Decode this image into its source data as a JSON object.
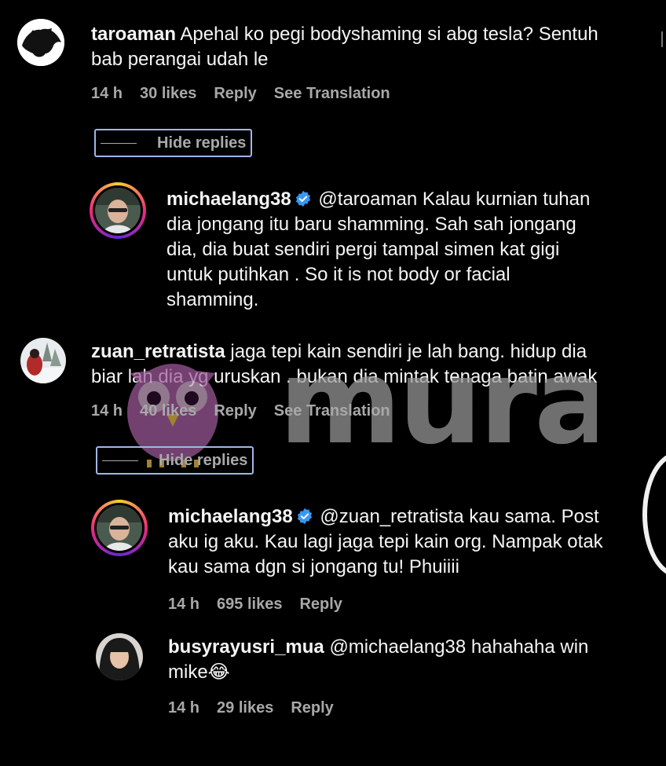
{
  "comments": [
    {
      "username": "taroaman",
      "text_line1": "Apehal ko pegi bodyshaming si abg tesla? Sentuh",
      "text_line2": "bab perangai udah le",
      "time": "14 h",
      "likes": "30 likes",
      "reply": "Reply",
      "translate": "See Translation",
      "hide_replies": "Hide replies",
      "replies": [
        {
          "username": "michaelang38",
          "mention": "@taroaman",
          "text_line1": "Kalau kurnian tuhan",
          "text_line2": "dia jongang itu baru shamming. Sah sah jongang",
          "text_line3": "dia, dia buat sendiri pergi tampal simen kat gigi",
          "text_line4": "untuk putihkan . So it is not body or facial",
          "text_line5": "shamming."
        }
      ]
    },
    {
      "username": "zuan_retratista",
      "text_line1": "jaga tepi kain sendiri je lah bang. hidup dia",
      "text_line2": "biar lah dia yg uruskan . bukan dia mintak tenaga batin awak",
      "time": "14 h",
      "likes": "40 likes",
      "reply": "Reply",
      "translate": "See Translation",
      "hide_replies": "Hide replies",
      "replies": [
        {
          "username": "michaelang38",
          "mention": "@zuan_retratista",
          "text_line1": "kau sama. Post",
          "text_line2": "aku ig aku. Kau lagi jaga tepi kain org. Nampak otak",
          "text_line3": "kau sama dgn si jongang tu! Phuiiii",
          "time": "14 h",
          "likes": "695 likes",
          "reply": "Reply"
        },
        {
          "username": "busyrayusri_mua",
          "mention": "@michaelang38",
          "text_line1": "hahahaha win",
          "text_line2": "mike😂",
          "time": "14 h",
          "likes": "29 likes",
          "reply": "Reply"
        }
      ]
    }
  ],
  "watermark": {
    "text": "murai"
  },
  "colors": {
    "background": "#000000",
    "text": "#f5f5f5",
    "meta": "#a8a8a8",
    "verified": "#3897f0",
    "focus_outline": "#9fb7e6",
    "watermark_owl": "#a05a9c"
  }
}
